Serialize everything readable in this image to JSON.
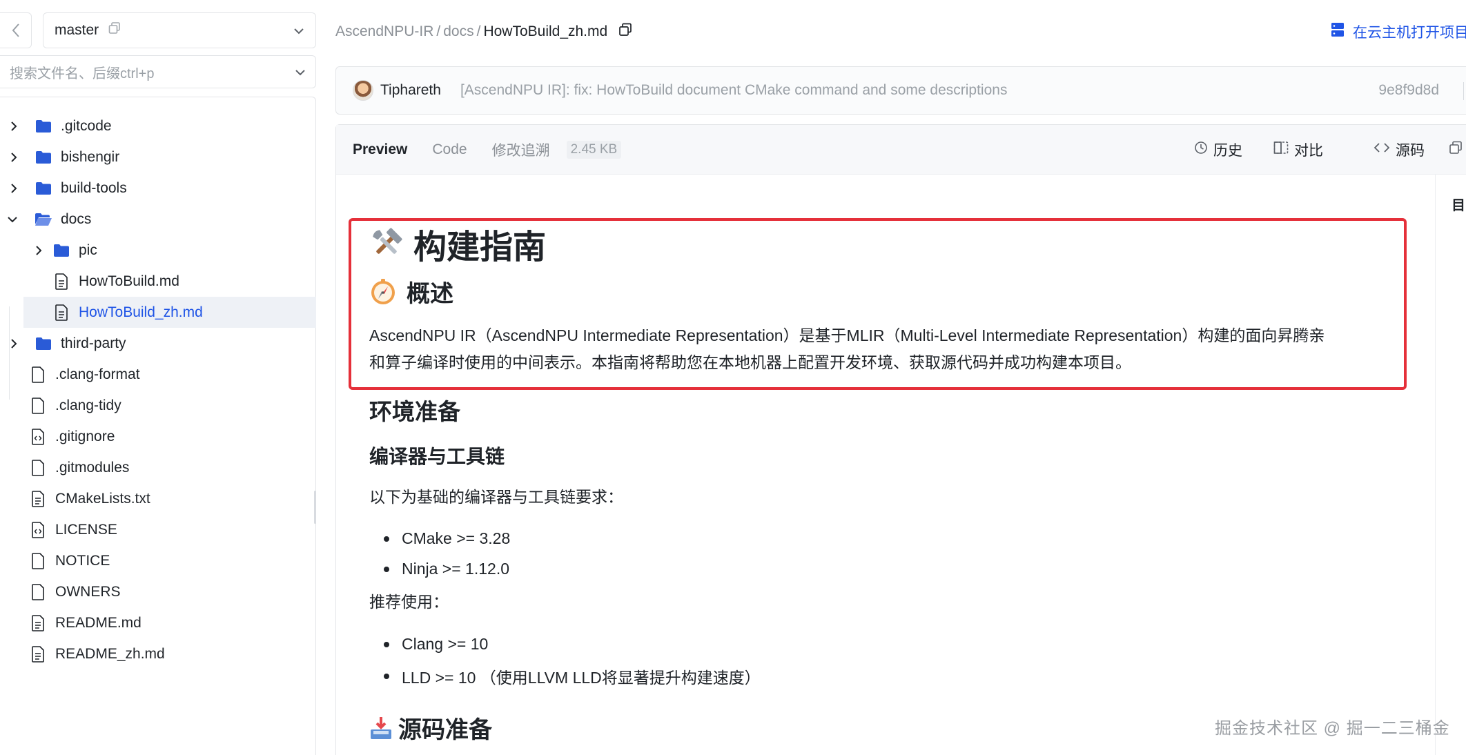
{
  "sidebar": {
    "branch": "master",
    "search_placeholder": "搜索文件名、后缀ctrl+p",
    "tree": [
      {
        "label": ".gitcode",
        "kind": "folder",
        "expanded": false
      },
      {
        "label": "bishengir",
        "kind": "folder",
        "expanded": false
      },
      {
        "label": "build-tools",
        "kind": "folder",
        "expanded": false
      },
      {
        "label": "docs",
        "kind": "folder",
        "expanded": true
      },
      {
        "label": "pic",
        "kind": "folder",
        "expanded": false
      },
      {
        "label": "HowToBuild.md",
        "kind": "markdown"
      },
      {
        "label": "HowToBuild_zh.md",
        "kind": "markdown",
        "active": true
      },
      {
        "label": "third-party",
        "kind": "folder",
        "expanded": false
      },
      {
        "label": ".clang-format",
        "kind": "file"
      },
      {
        "label": ".clang-tidy",
        "kind": "file"
      },
      {
        "label": ".gitignore",
        "kind": "code"
      },
      {
        "label": ".gitmodules",
        "kind": "file"
      },
      {
        "label": "CMakeLists.txt",
        "kind": "text"
      },
      {
        "label": "LICENSE",
        "kind": "code"
      },
      {
        "label": "NOTICE",
        "kind": "file"
      },
      {
        "label": "OWNERS",
        "kind": "file"
      },
      {
        "label": "README.md",
        "kind": "markdown"
      },
      {
        "label": "README_zh.md",
        "kind": "markdown"
      }
    ]
  },
  "breadcrumb": {
    "repo": "AscendNPU-IR",
    "folder": "docs",
    "file": "HowToBuild_zh.md",
    "separator": "/"
  },
  "header": {
    "open_cloud": "在云主机打开项目"
  },
  "commit": {
    "author": "Tiphareth",
    "message": "[AscendNPU IR]: fix: HowToBuild document CMake command and some descriptions",
    "hash": "9e8f9d8d"
  },
  "file_toolbar": {
    "tabs": [
      "Preview",
      "Code",
      "修改追溯"
    ],
    "size": "2.45 KB",
    "history": "历史",
    "compare": "对比",
    "source": "源码"
  },
  "toc_label": "目",
  "content": {
    "h1": "构建指南",
    "overview_heading": "概述",
    "overview_line1": "AscendNPU IR（AscendNPU Intermediate Representation）是基于MLIR（Multi-Level Intermediate Representation）构建的面向昇腾亲",
    "overview_line2": "和算子编译时使用的中间表示。本指南将帮助您在本地机器上配置开发环境、获取源代码并成功构建本项目。",
    "env_heading": "环境准备",
    "toolchain_heading": "编译器与工具链",
    "toolchain_intro": "以下为基础的编译器与工具链要求：",
    "requirements": [
      "CMake >= 3.28",
      "Ninja >= 1.12.0"
    ],
    "recommended_intro": "推荐使用：",
    "recommended": [
      "Clang >= 10",
      "LLD >= 10 （使用LLVM LLD将显著提升构建速度）"
    ],
    "source_heading": "源码准备"
  },
  "watermark": "掘金技术社区 @ 掘一二三桶金",
  "colors": {
    "accent": "#1f54e6",
    "highlight": "#e5303a",
    "folder": "#2a5bd7"
  }
}
